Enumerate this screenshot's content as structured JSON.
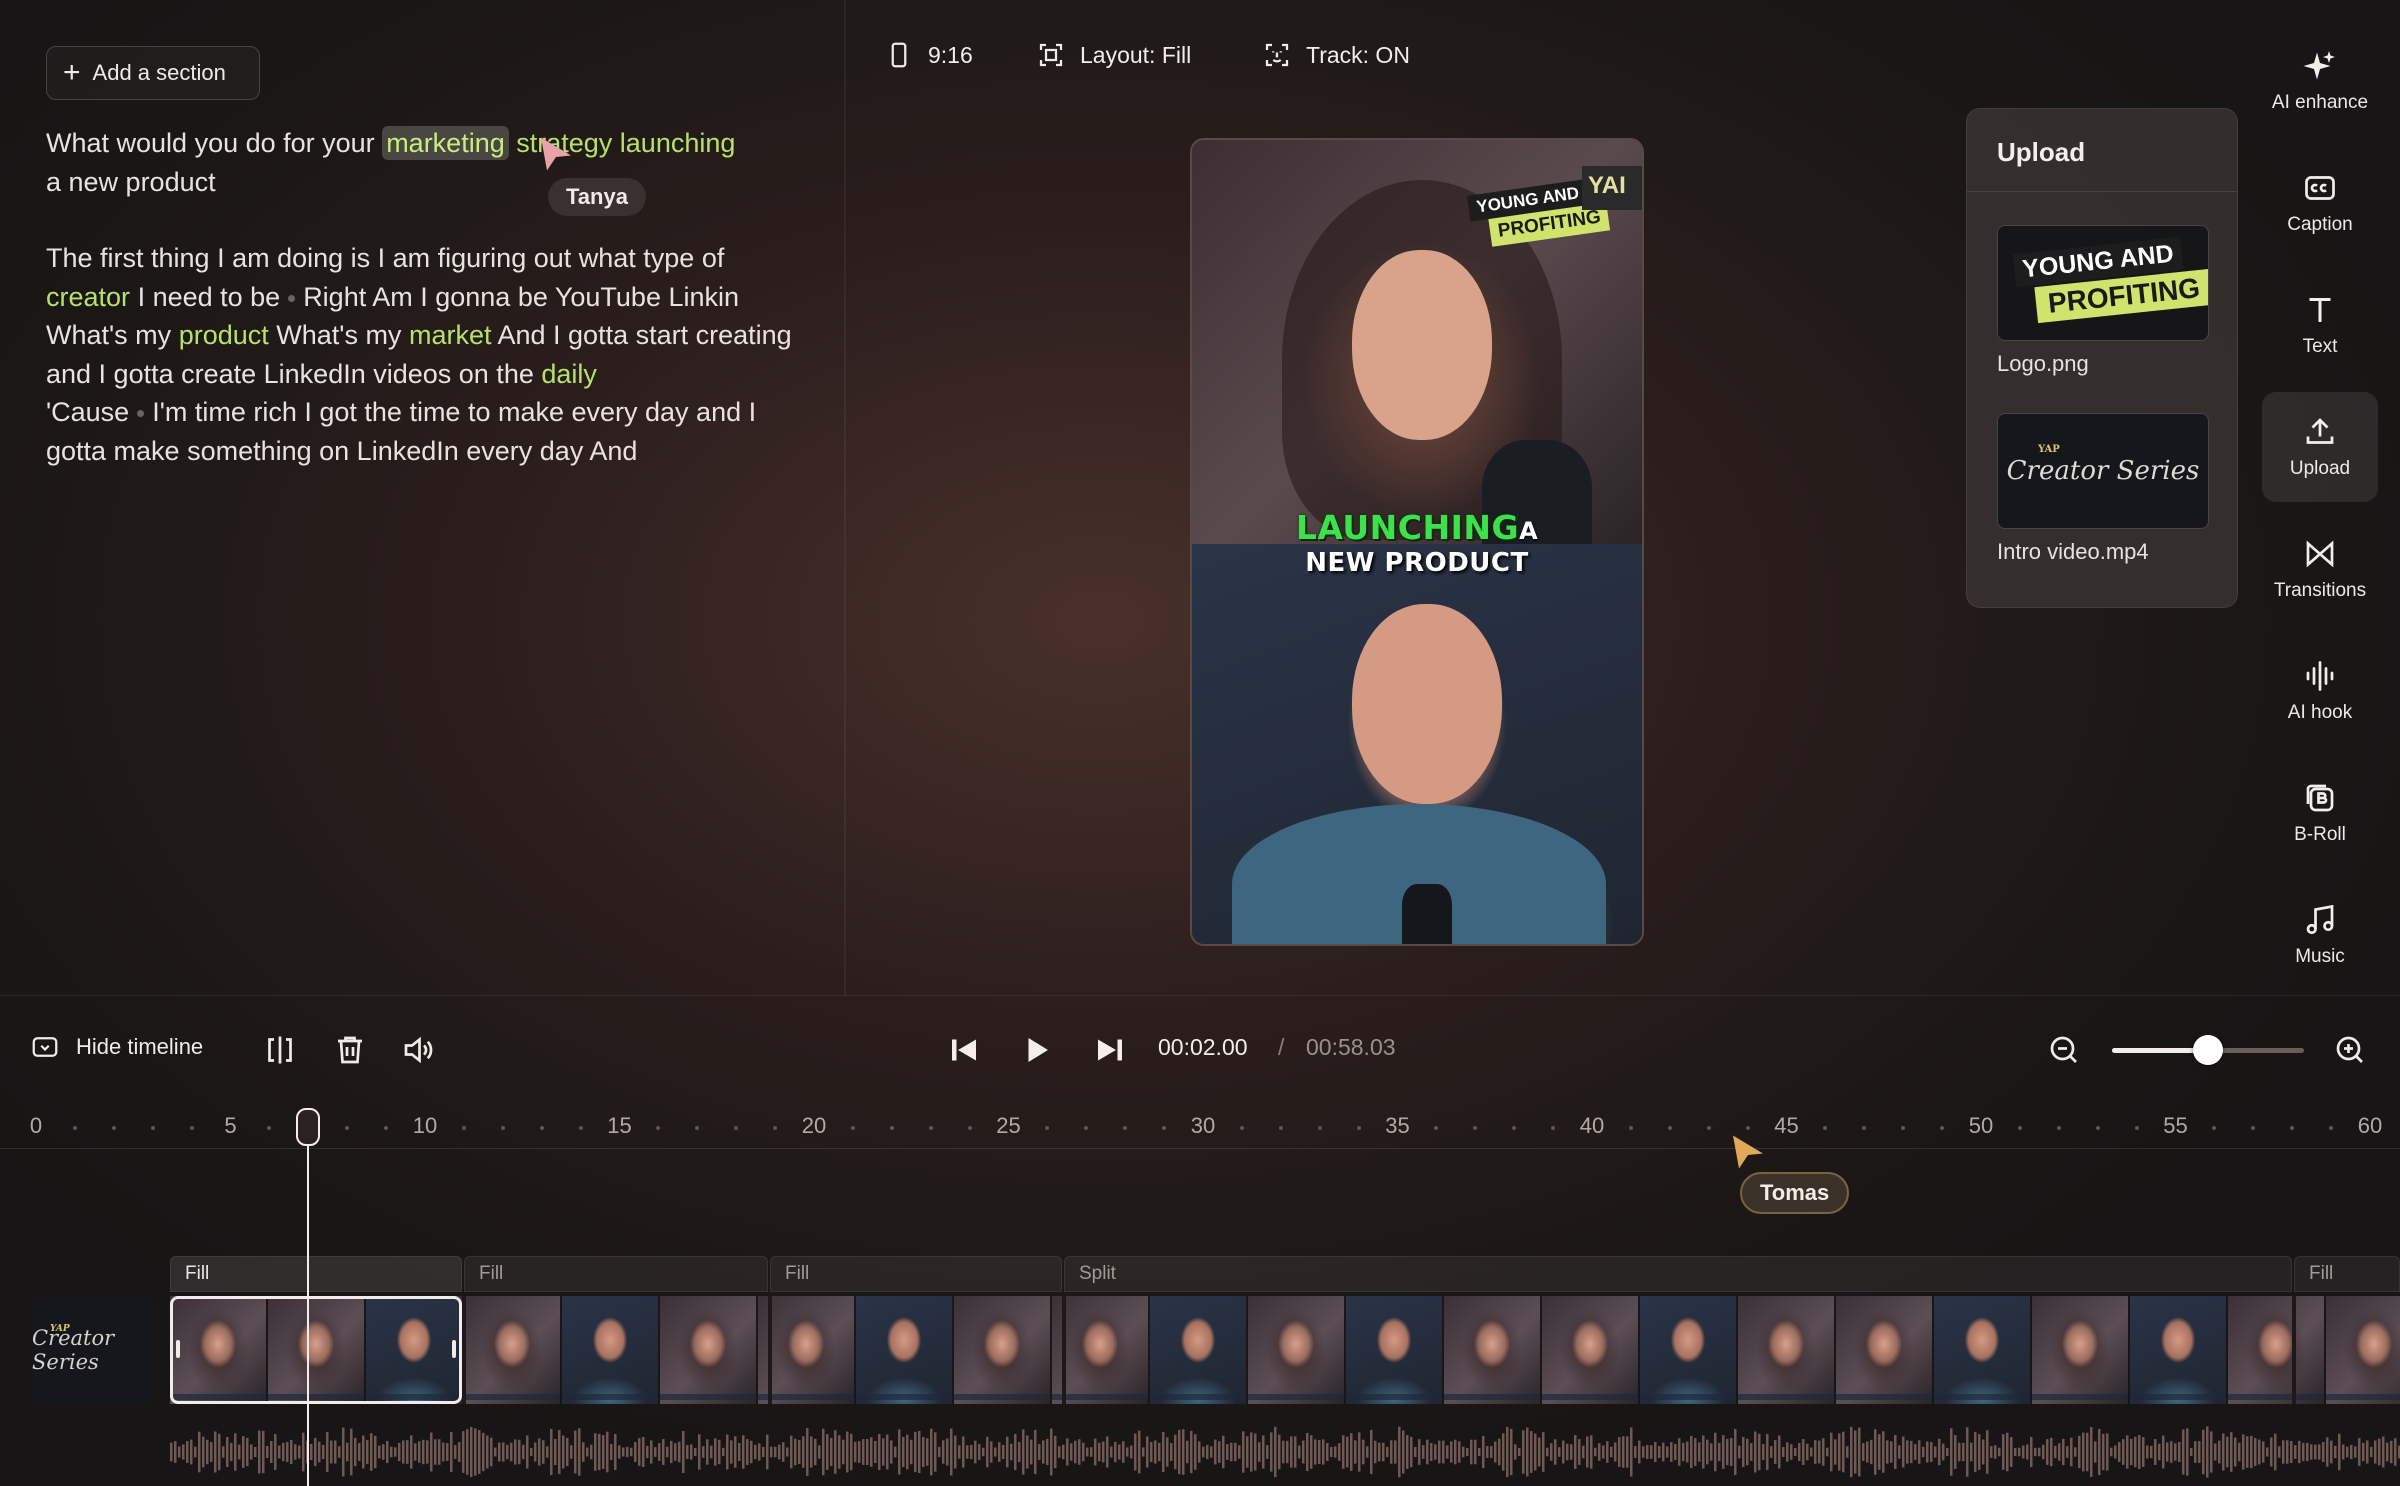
{
  "toolbar": {
    "add_section": "Add a section",
    "aspect": "9:16",
    "layout": "Layout: Fill",
    "track": "Track: ON"
  },
  "transcript": {
    "p1": {
      "before": "What would you do for your",
      "hl1": "marketing",
      "hl2": "strategy launching",
      "after": "a new product"
    },
    "p2": {
      "t1": "The first thing I am doing is I am figuring out what type of",
      "hl1": "creator",
      "t2": "I need to be",
      "t3": "Right Am I gonna be YouTube Linkin What's my",
      "hl2": "product",
      "t4": "What's my",
      "hl3": "market",
      "t5": "And I gotta start creating and I gotta create LinkedIn videos on the",
      "hl4": "daily",
      "t6": "'Cause",
      "t7": "I'm time rich I got the time to make every day and I gotta make something on LinkedIn every day And"
    }
  },
  "collaborators": [
    {
      "name": "Tanya",
      "color": "#e8a3a9"
    },
    {
      "name": "Tomas",
      "color": "#e0a95a"
    }
  ],
  "preview": {
    "logo_line1": "YOUNG AND",
    "logo_line2": "PROFITING",
    "corner_text": "YAI",
    "caption_highlight": "LAUNCHING",
    "caption_word": "A",
    "caption_line2": "NEW PRODUCT"
  },
  "upload_panel": {
    "title": "Upload",
    "items": [
      {
        "name": "Logo.png",
        "logo_line1": "YOUNG AND",
        "logo_line2": "PROFITING"
      },
      {
        "name": "Intro video.mp4",
        "script_text": "Creator Series",
        "badge": "YAP"
      }
    ]
  },
  "right_toolbar": [
    {
      "label": "AI enhance",
      "icon": "sparkle-icon"
    },
    {
      "label": "Caption",
      "icon": "cc-icon"
    },
    {
      "label": "Text",
      "icon": "text-icon"
    },
    {
      "label": "Upload",
      "icon": "upload-icon",
      "active": true
    },
    {
      "label": "Transitions",
      "icon": "transitions-icon"
    },
    {
      "label": "AI hook",
      "icon": "waveform-icon"
    },
    {
      "label": "B-Roll",
      "icon": "broll-icon"
    },
    {
      "label": "Music",
      "icon": "music-note-icon"
    }
  ],
  "timeline": {
    "hide_label": "Hide timeline",
    "current_time": "00:02.00",
    "separator": "/",
    "total_time": "00:58.03",
    "zoom_level": 0.5,
    "ruler_ticks": [
      "0",
      "5",
      "10",
      "15",
      "20",
      "25",
      "30",
      "35",
      "40",
      "45",
      "50",
      "55",
      "60"
    ],
    "playhead_seconds": 7,
    "segments": [
      {
        "label": "Fill",
        "selected": true
      },
      {
        "label": "Fill"
      },
      {
        "label": "Fill"
      },
      {
        "label": "Split"
      },
      {
        "label": "Fill"
      }
    ],
    "intro_clip_text": "Creator Series",
    "intro_clip_badge": "YAP"
  },
  "colors": {
    "accent_green": "#b7e26a",
    "caption_green": "#3ce24a",
    "logo_yellow": "#cfe36d"
  }
}
